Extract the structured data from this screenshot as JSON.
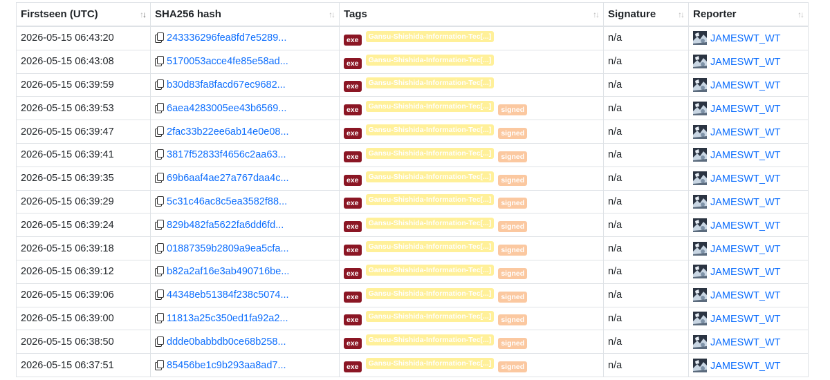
{
  "columns": [
    {
      "label": "Firstseen (UTC)",
      "sort": "desc"
    },
    {
      "label": "SHA256 hash",
      "sort": "none"
    },
    {
      "label": "Tags",
      "sort": "none"
    },
    {
      "label": "Signature",
      "sort": "none"
    },
    {
      "label": "Reporter",
      "sort": "none"
    }
  ],
  "colors": {
    "exe": "#8b1624",
    "org_tag": "#fff099",
    "signed": "#fbc8a0",
    "link": "#0d6efd"
  },
  "rows": [
    {
      "firstseen": "2026-05-15 06:43:20",
      "hash": "243336296fea8fd7e5289...",
      "tags": [
        "exe",
        "Gansu-Shishida-Information-Tec[...]"
      ],
      "signature": "n/a",
      "reporter": "JAMESWT_WT"
    },
    {
      "firstseen": "2026-05-15 06:43:08",
      "hash": "5170053acce4fe85e58ad...",
      "tags": [
        "exe",
        "Gansu-Shishida-Information-Tec[...]"
      ],
      "signature": "n/a",
      "reporter": "JAMESWT_WT"
    },
    {
      "firstseen": "2026-05-15 06:39:59",
      "hash": "b30d83fa8facd67ec9682...",
      "tags": [
        "exe",
        "Gansu-Shishida-Information-Tec[...]"
      ],
      "signature": "n/a",
      "reporter": "JAMESWT_WT"
    },
    {
      "firstseen": "2026-05-15 06:39:53",
      "hash": "6aea4283005ee43b6569...",
      "tags": [
        "exe",
        "Gansu-Shishida-Information-Tec[...]",
        "signed"
      ],
      "signature": "n/a",
      "reporter": "JAMESWT_WT"
    },
    {
      "firstseen": "2026-05-15 06:39:47",
      "hash": "2fac33b22ee6ab14e0e08...",
      "tags": [
        "exe",
        "Gansu-Shishida-Information-Tec[...]",
        "signed"
      ],
      "signature": "n/a",
      "reporter": "JAMESWT_WT"
    },
    {
      "firstseen": "2026-05-15 06:39:41",
      "hash": "3817f52833f4656c2aa63...",
      "tags": [
        "exe",
        "Gansu-Shishida-Information-Tec[...]",
        "signed"
      ],
      "signature": "n/a",
      "reporter": "JAMESWT_WT"
    },
    {
      "firstseen": "2026-05-15 06:39:35",
      "hash": "69b6aaf4ae27a767daa4c...",
      "tags": [
        "exe",
        "Gansu-Shishida-Information-Tec[...]",
        "signed"
      ],
      "signature": "n/a",
      "reporter": "JAMESWT_WT"
    },
    {
      "firstseen": "2026-05-15 06:39:29",
      "hash": "5c31c46ac8c5ea3582f88...",
      "tags": [
        "exe",
        "Gansu-Shishida-Information-Tec[...]",
        "signed"
      ],
      "signature": "n/a",
      "reporter": "JAMESWT_WT"
    },
    {
      "firstseen": "2026-05-15 06:39:24",
      "hash": "829b482fa5622fa6dd6fd...",
      "tags": [
        "exe",
        "Gansu-Shishida-Information-Tec[...]",
        "signed"
      ],
      "signature": "n/a",
      "reporter": "JAMESWT_WT"
    },
    {
      "firstseen": "2026-05-15 06:39:18",
      "hash": "01887359b2809a9ea5cfa...",
      "tags": [
        "exe",
        "Gansu-Shishida-Information-Tec[...]",
        "signed"
      ],
      "signature": "n/a",
      "reporter": "JAMESWT_WT"
    },
    {
      "firstseen": "2026-05-15 06:39:12",
      "hash": "b82a2af16e3ab490716be...",
      "tags": [
        "exe",
        "Gansu-Shishida-Information-Tec[...]",
        "signed"
      ],
      "signature": "n/a",
      "reporter": "JAMESWT_WT"
    },
    {
      "firstseen": "2026-05-15 06:39:06",
      "hash": "44348eb51384f238c5074...",
      "tags": [
        "exe",
        "Gansu-Shishida-Information-Tec[...]",
        "signed"
      ],
      "signature": "n/a",
      "reporter": "JAMESWT_WT"
    },
    {
      "firstseen": "2026-05-15 06:39:00",
      "hash": "11813a25c350ed1fa92a2...",
      "tags": [
        "exe",
        "Gansu-Shishida-Information-Tec[...]",
        "signed"
      ],
      "signature": "n/a",
      "reporter": "JAMESWT_WT"
    },
    {
      "firstseen": "2026-05-15 06:38:50",
      "hash": "ddde0babbdb0ce68b258...",
      "tags": [
        "exe",
        "Gansu-Shishida-Information-Tec[...]",
        "signed"
      ],
      "signature": "n/a",
      "reporter": "JAMESWT_WT"
    },
    {
      "firstseen": "2026-05-15 06:37:51",
      "hash": "85456be1c9b293aa8ad7...",
      "tags": [
        "exe",
        "Gansu-Shishida-Information-Tec[...]",
        "signed"
      ],
      "signature": "n/a",
      "reporter": "JAMESWT_WT"
    }
  ]
}
